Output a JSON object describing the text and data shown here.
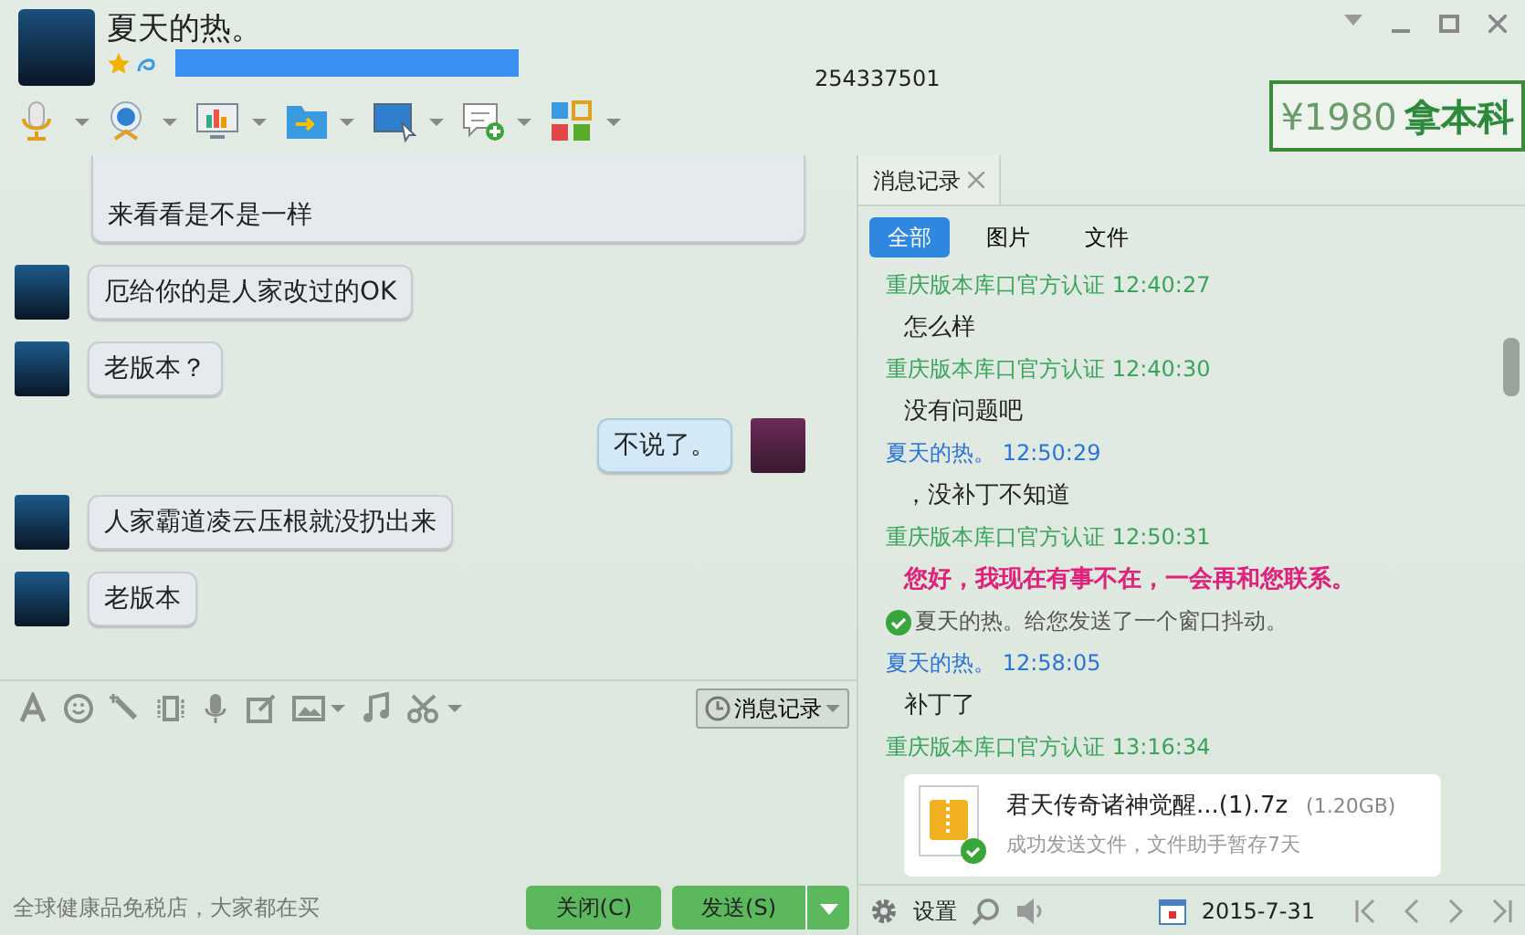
{
  "window": {
    "title": "夏天的热。",
    "number": "254337501",
    "ad": {
      "price": "¥1980",
      "text": "拿本科"
    }
  },
  "chat": [
    {
      "kind": "quote",
      "text": "来看看是不是一样"
    },
    {
      "kind": "received",
      "text": "厄给你的是人家改过的OK"
    },
    {
      "kind": "received",
      "text": "老版本？"
    },
    {
      "kind": "sent",
      "text": "不说了。"
    },
    {
      "kind": "received",
      "text": "人家霸道凌云压根就没扔出来"
    },
    {
      "kind": "received",
      "text": "老版本"
    }
  ],
  "input": {
    "history_button": "消息记录"
  },
  "footer": {
    "ad": "全球健康品免税店，大家都在买",
    "buttons": [
      {
        "label": "关闭(C)",
        "kind": "close"
      },
      {
        "label": "发送(S)",
        "kind": "send"
      }
    ]
  },
  "history": {
    "tab": "消息记录",
    "filters": [
      {
        "label": "全部",
        "selected": true
      },
      {
        "label": "图片",
        "selected": false
      },
      {
        "label": "文件",
        "selected": false
      }
    ],
    "entries": [
      {
        "kind": "header",
        "sender": "重庆版本库口官方认证",
        "time": "12:40:27",
        "self": false
      },
      {
        "kind": "text",
        "text": "怎么样"
      },
      {
        "kind": "header",
        "sender": "重庆版本库口官方认证",
        "time": "12:40:30",
        "self": false
      },
      {
        "kind": "text",
        "text": "没有问题吧"
      },
      {
        "kind": "header",
        "sender": "夏天的热。",
        "time": "12:50:29",
        "self": true
      },
      {
        "kind": "text",
        "text": "，没补丁不知道"
      },
      {
        "kind": "header",
        "sender": "重庆版本库口官方认证",
        "time": "12:50:31",
        "self": false
      },
      {
        "kind": "auto",
        "text": "您好，我现在有事不在，一会再和您联系。"
      },
      {
        "kind": "system",
        "text": "夏天的热。给您发送了一个窗口抖动。"
      },
      {
        "kind": "header",
        "sender": "夏天的热。",
        "time": "12:58:05",
        "self": true
      },
      {
        "kind": "text",
        "text": "补丁了"
      },
      {
        "kind": "header",
        "sender": "重庆版本库口官方认证",
        "time": "13:16:34",
        "self": false
      },
      {
        "kind": "file",
        "name": "君天传奇诸神觉醒...(1).7z",
        "size": "(1.20GB)",
        "status": "成功发送文件，文件助手暂存7天"
      }
    ],
    "settings": "设置",
    "date": "2015-7-31"
  }
}
